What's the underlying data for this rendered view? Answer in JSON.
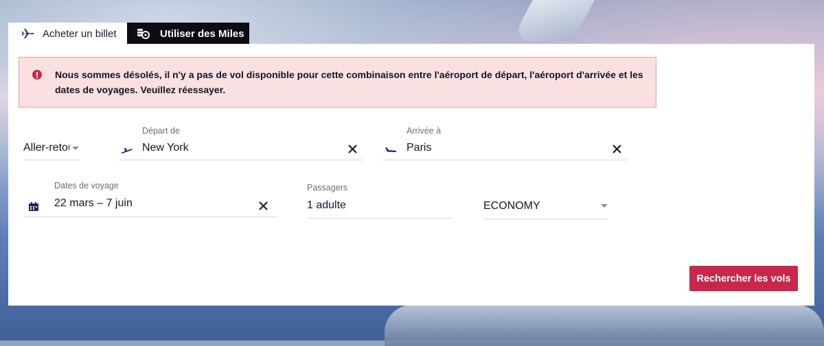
{
  "tabs": [
    {
      "label": "Acheter un billet",
      "icon": "plane-icon",
      "active": true
    },
    {
      "label": "Utiliser des Miles",
      "icon": "miles-coins-icon",
      "active": false
    }
  ],
  "alert": {
    "message": "Nous sommes désolés, il n'y a pas de vol disponible pour cette combinaison entre l'aéroport de départ, l'aéroport d'arrivée et les dates de voyages. Veuillez réessayer.",
    "icon": "error-icon",
    "color": "#c8274a"
  },
  "trip_type": {
    "value": "Aller-retour"
  },
  "departure": {
    "label": "Départ de",
    "value": "New York",
    "icon": "takeoff-icon"
  },
  "arrival": {
    "label": "Arrivée à",
    "value": "Paris",
    "icon": "landing-icon"
  },
  "dates": {
    "label": "Dates de voyage",
    "value": "22 mars – 7 juin",
    "icon": "calendar-icon"
  },
  "passengers": {
    "label": "Passagers",
    "value": "1 adulte"
  },
  "cabin_class": {
    "value": "ECONOMY"
  },
  "search_button": {
    "label": "Rechercher les vols",
    "color": "#c8274a"
  }
}
